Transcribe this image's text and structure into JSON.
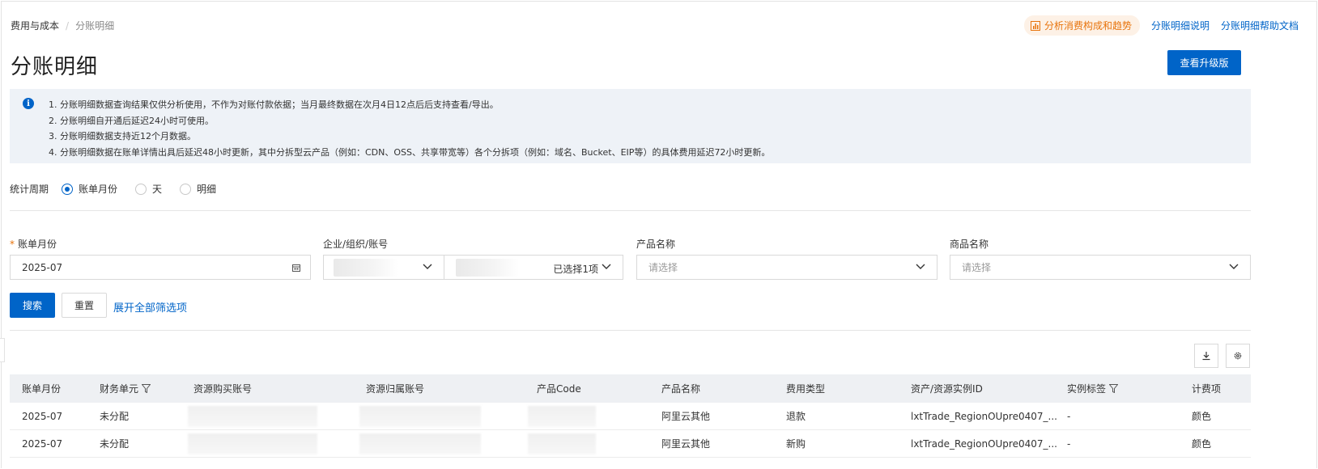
{
  "breadcrumb": {
    "root": "费用与成本",
    "current": "分账明细"
  },
  "top_links": {
    "analyze": "分析消费构成和趋势",
    "explain": "分账明细说明",
    "help": "分账明细帮助文档"
  },
  "title": "分账明细",
  "upgrade_label": "查看升级版",
  "notice": {
    "lines": [
      "1. 分账明细数据查询结果仅供分析使用，不作为对账付款依据；当月最终数据在次月4日12点后后支持查看/导出。",
      "2. 分账明细自开通后延迟24小时可使用。",
      "3. 分账明细数据支持近12个月数据。",
      "4. 分账明细数据在账单详情出具后延迟48小时更新，其中分拆型云产品（例如：CDN、OSS、共享带宽等）各个分拆项（例如：域名、Bucket、EIP等）的具体费用延迟72小时更新。"
    ]
  },
  "period": {
    "label": "统计周期",
    "options": [
      "账单月份",
      "天",
      "明细"
    ],
    "selected": "账单月份"
  },
  "filters": {
    "billing_month": {
      "label": "账单月份",
      "value": "2025-07"
    },
    "account": {
      "label": "企业/组织/账号",
      "selected_text": "已选择1项"
    },
    "product_name": {
      "label": "产品名称",
      "placeholder": "请选择"
    },
    "commodity_name": {
      "label": "商品名称",
      "placeholder": "请选择"
    }
  },
  "actions": {
    "search": "搜索",
    "reset": "重置",
    "expand": "展开全部筛选项"
  },
  "table": {
    "columns": [
      "账单月份",
      "财务单元",
      "资源购买账号",
      "资源归属账号",
      "产品Code",
      "产品名称",
      "费用类型",
      "资产/资源实例ID",
      "实例标签",
      "计费项"
    ],
    "rows": [
      {
        "month": "2025-07",
        "unit": "未分配",
        "product_name": "阿里云其他",
        "fee_type": "退款",
        "instance_id": "lxtTrade_RegionOUpre0407_...",
        "tag": "-",
        "billing_item": "颜色"
      },
      {
        "month": "2025-07",
        "unit": "未分配",
        "product_name": "阿里云其他",
        "fee_type": "新购",
        "instance_id": "lxtTrade_RegionOUpre0407_...",
        "tag": "-",
        "billing_item": "颜色"
      }
    ]
  },
  "colors": {
    "primary": "#0064c8",
    "accent_orange": "#e8740c",
    "notice_bg": "#eef2f7"
  }
}
